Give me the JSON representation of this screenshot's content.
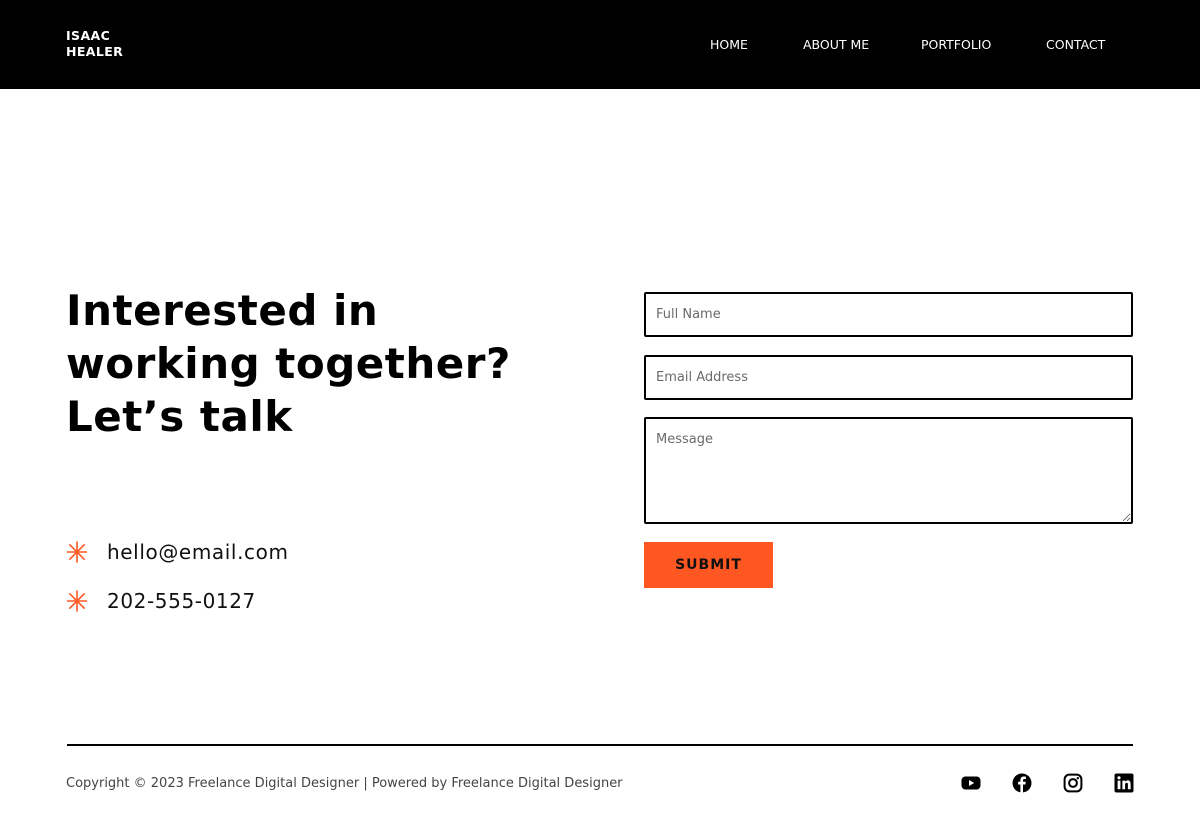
{
  "header": {
    "logo_line1": "ISAAC",
    "logo_line2": "HEALER",
    "nav": [
      {
        "label": "HOME"
      },
      {
        "label": "ABOUT ME"
      },
      {
        "label": "PORTFOLIO"
      },
      {
        "label": "CONTACT"
      }
    ]
  },
  "hero": {
    "heading_lines": [
      "Interested in",
      "working together?",
      "Let’s talk"
    ],
    "contacts": [
      {
        "icon": "asterisk-icon",
        "text": "hello@email.com"
      },
      {
        "icon": "asterisk-icon",
        "text": "202-555-0127"
      }
    ],
    "accent_color": "#ff5722"
  },
  "form": {
    "full_name_placeholder": "Full Name",
    "email_placeholder": "Email Address",
    "message_placeholder": "Message",
    "submit_label": "SUBMIT"
  },
  "footer": {
    "copyright": "Copyright © 2023 Freelance Digital Designer | Powered by Freelance Digital Designer",
    "social": [
      {
        "icon": "youtube-icon"
      },
      {
        "icon": "facebook-icon"
      },
      {
        "icon": "instagram-icon"
      },
      {
        "icon": "linkedin-icon"
      }
    ]
  }
}
